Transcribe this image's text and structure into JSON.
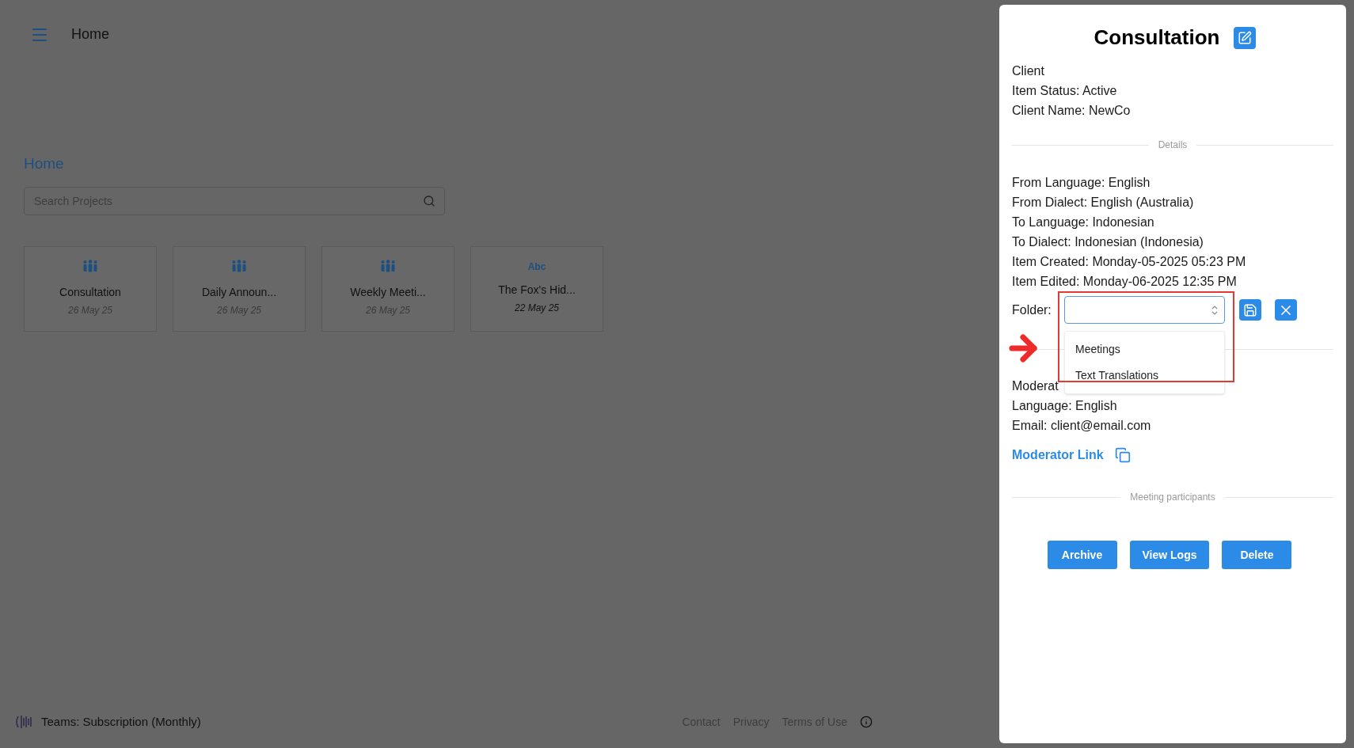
{
  "header": {
    "title": "Home"
  },
  "page": {
    "title": "Home",
    "search": {
      "placeholder": "Search Projects"
    }
  },
  "projects": [
    {
      "kind": "meeting",
      "name": "Consultation",
      "date": "26 May 25"
    },
    {
      "kind": "meeting",
      "name": "Daily Announ...",
      "date": "26 May 25"
    },
    {
      "kind": "meeting",
      "name": "Weekly Meeti...",
      "date": "26 May 25"
    },
    {
      "kind": "text",
      "badge": "Abc",
      "name": "The Fox's Hid...",
      "date": "22 May 25"
    }
  ],
  "footer": {
    "plan": "Teams: Subscription (Monthly)",
    "links": [
      "Contact",
      "Privacy",
      "Terms of Use"
    ]
  },
  "panel": {
    "title": "Consultation",
    "client_lines": [
      "Client",
      "Item Status: Active",
      "Client Name: NewCo"
    ],
    "details_heading": "Details",
    "details": [
      "From Language: English",
      "From Dialect: English (Australia)",
      "To Language: Indonesian",
      "To Dialect: Indonesian (Indonesia)",
      "Item Created: Monday-05-2025 05:23 PM",
      "Item Edited: Monday-06-2025 12:35 PM"
    ],
    "folder": {
      "label": "Folder:",
      "expanded": true,
      "options": [
        {
          "label": "Meetings",
          "selected": false
        },
        {
          "label": "Text Translations",
          "selected": false
        }
      ]
    },
    "moderator_lines": [
      "Moderat",
      "Language: English",
      "Email: client@email.com"
    ],
    "moderator_link": "Moderator Link",
    "participants_heading": "Meeting participants",
    "buttons": [
      "Archive",
      "View Logs",
      "Delete"
    ]
  }
}
